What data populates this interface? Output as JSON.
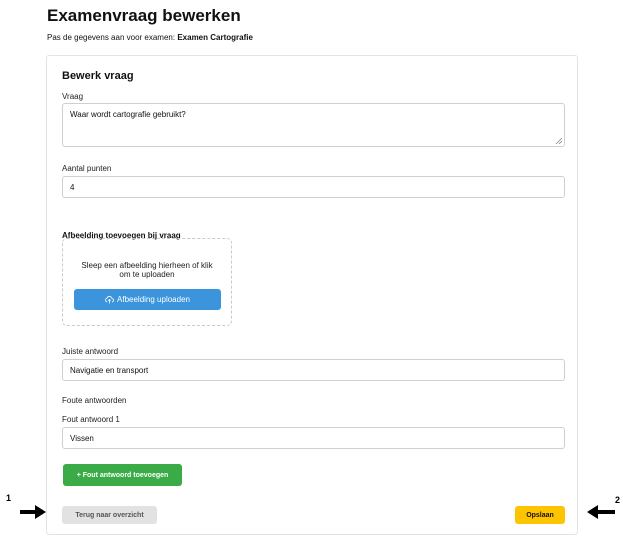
{
  "header": {
    "title": "Examenvraag bewerken",
    "subtitle_prefix": "Pas de gegevens aan voor examen:",
    "exam_name": "Examen Cartografie"
  },
  "form": {
    "card_title": "Bewerk vraag",
    "question_label": "Vraag",
    "question_value": "Waar wordt cartografie gebruikt?",
    "points_label": "Aantal punten",
    "points_value": "4",
    "image_section_title": "Afbeelding toevoegen bij vraag",
    "dropzone_text": "Sleep een afbeelding hierheen of klik om te uploaden",
    "upload_button": "Afbeelding uploaden",
    "correct_answer_label": "Juiste antwoord",
    "correct_answer_value": "Navigatie en transport",
    "wrong_answers_title": "Foute antwoorden",
    "wrong_answers": [
      {
        "label": "Fout antwoord 1",
        "value": "Vissen"
      }
    ],
    "add_wrong_answer_button": "+ Fout antwoord toevoegen",
    "back_button": "Terug naar overzicht",
    "save_button": "Opslaan"
  },
  "annotations": {
    "marker_1": "1",
    "marker_2": "2"
  },
  "colors": {
    "upload_blue": "#3b94dc",
    "add_green": "#3aab47",
    "save_yellow": "#ffc400",
    "back_gray": "#e2e2e2"
  },
  "icons": {
    "upload": "cloud-upload-icon",
    "resize": "resize-grip-icon",
    "arrow_right": "arrow-right-icon",
    "arrow_left": "arrow-left-icon"
  }
}
